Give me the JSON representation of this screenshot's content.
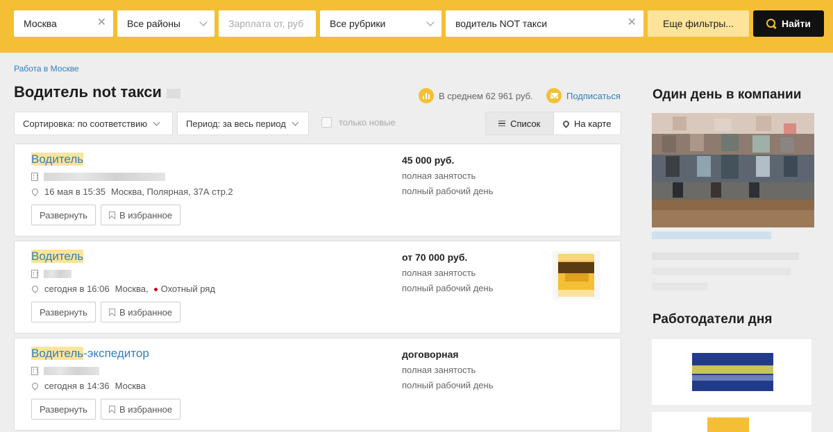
{
  "search": {
    "city": "Москва",
    "district": "Все районы",
    "salary_placeholder": "Зарплата от, руб",
    "category": "Все рубрики",
    "query": "водитель NOT такси",
    "more_filters": "Еще фильтры...",
    "find": "Найти"
  },
  "breadcrumb": "Работа в Москве",
  "page_title": "Водитель not такси",
  "average_salary": "В среднем 62 961 руб.",
  "subscribe": "Подписаться",
  "filters": {
    "sort": "Сортировка: по соответствию",
    "period": "Период: за весь период",
    "only_new": "только новые"
  },
  "view": {
    "list": "Список",
    "map": "На карте"
  },
  "vacancies": [
    {
      "title_hl": "Водитель",
      "title_rest": "",
      "date": "16 мая в 15:35",
      "location": "Москва, Полярная, 37А стр.2",
      "metro": "",
      "salary": "45 000 руб.",
      "employment": "полная занятость",
      "schedule": "полный рабочий день"
    },
    {
      "title_hl": "Водитель",
      "title_rest": "",
      "date": "сегодня в 16:06",
      "location": "Москва,",
      "metro": "Охотный ряд",
      "salary": "от 70 000 руб.",
      "employment": "полная занятость",
      "schedule": "полный рабочий день"
    },
    {
      "title_hl": "Водитель",
      "title_rest": "-экспедитор",
      "date": "сегодня в 14:36",
      "location": "Москва",
      "metro": "",
      "salary": "договорная",
      "employment": "полная занятость",
      "schedule": "полный рабочий день"
    }
  ],
  "card_buttons": {
    "expand": "Развернуть",
    "favorite": "В избранное"
  },
  "sidebar": {
    "company_day": "Один день в компании",
    "employers_day": "Работодатели дня"
  },
  "colors": {
    "brand_yellow": "#f4bf34",
    "link_blue": "#2d7fc1",
    "highlight": "#fde49a",
    "metro_red": "#d0021b"
  }
}
